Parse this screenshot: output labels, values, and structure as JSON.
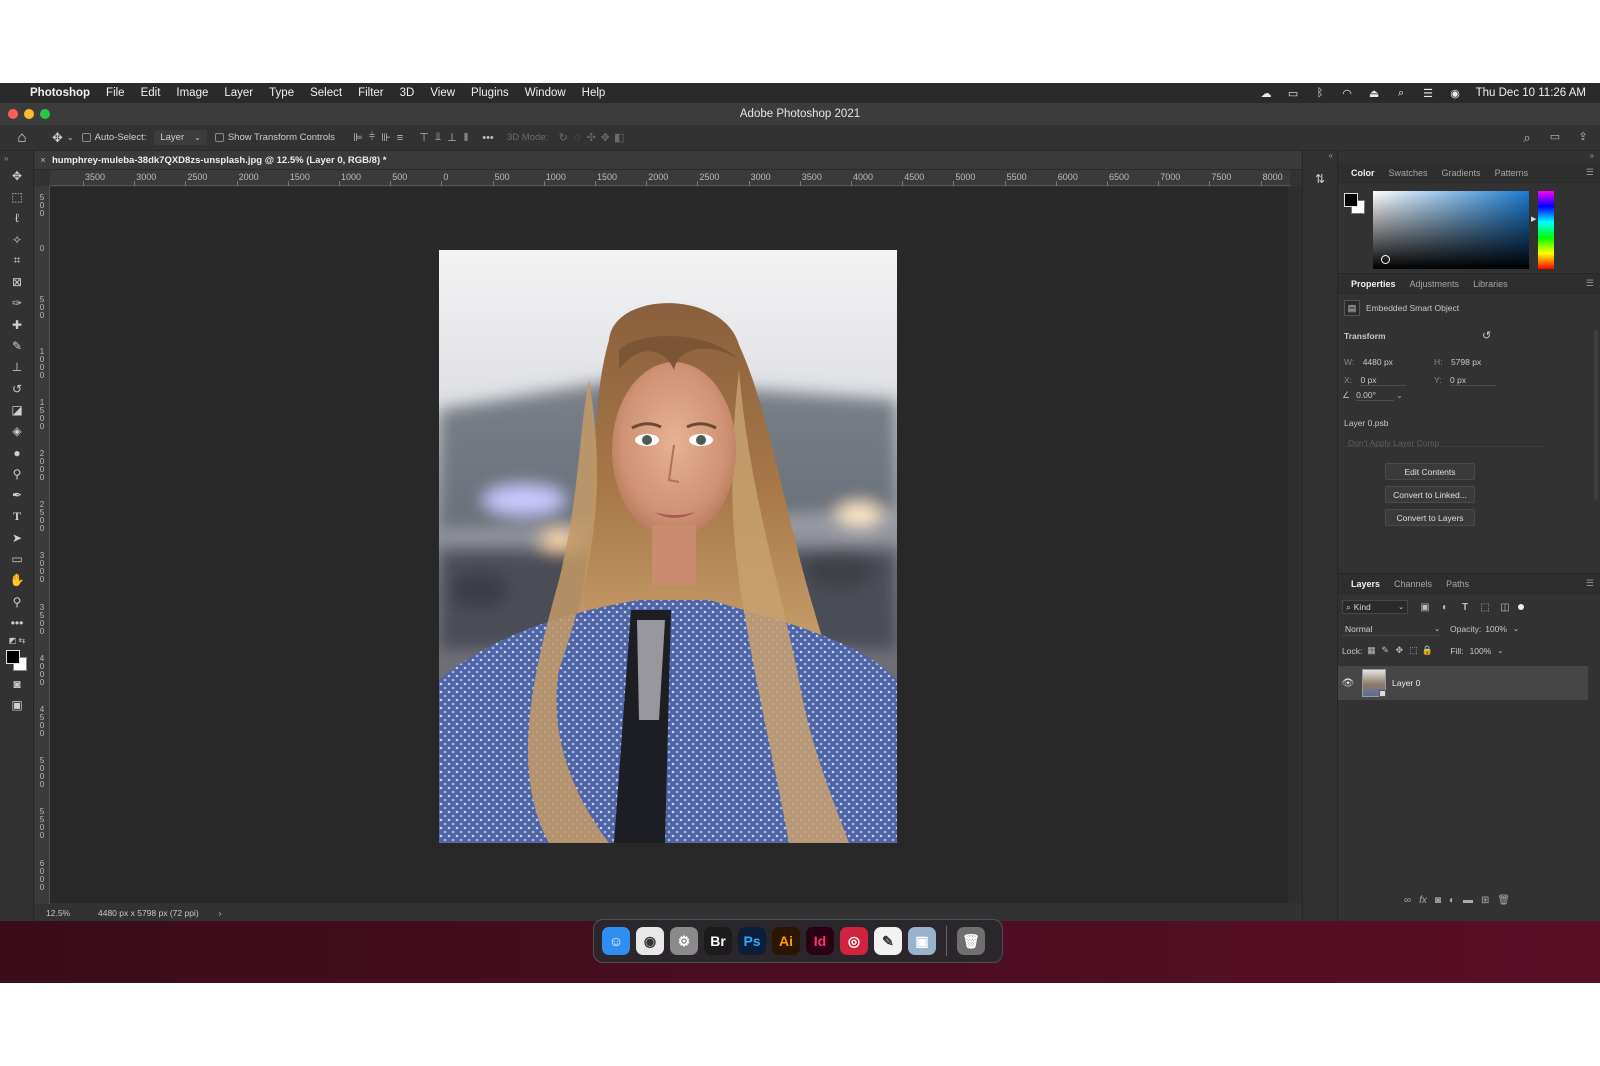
{
  "menubar": {
    "app_name": "Photoshop",
    "items": [
      "File",
      "Edit",
      "Image",
      "Layer",
      "Type",
      "Select",
      "Filter",
      "3D",
      "View",
      "Plugins",
      "Window",
      "Help"
    ],
    "clock": "Thu Dec 10  11:26 AM"
  },
  "window": {
    "title": "Adobe Photoshop 2021"
  },
  "options_bar": {
    "auto_select_label": "Auto-Select:",
    "auto_select_value": "Layer",
    "show_transform_label": "Show Transform Controls",
    "mode_3d_label": "3D Mode:"
  },
  "document": {
    "tab_title": "humphrey-muleba-38dk7QXD8zs-unsplash.jpg @ 12.5% (Layer 0, RGB/8) *"
  },
  "ruler": {
    "h_ticks": [
      "3500",
      "3000",
      "2500",
      "2000",
      "1500",
      "1000",
      "500",
      "0",
      "500",
      "1000",
      "1500",
      "2000",
      "2500",
      "3000",
      "3500",
      "4000",
      "4500",
      "5000",
      "5500",
      "6000",
      "6500",
      "7000",
      "7500",
      "8000"
    ],
    "v_ticks": [
      "500",
      "0",
      "500",
      "1000",
      "1500",
      "2000",
      "2500",
      "3000",
      "3500",
      "4000",
      "4500",
      "5000",
      "5500",
      "6000"
    ]
  },
  "status": {
    "zoom": "12.5%",
    "doc_info": "4480 px x 5798 px (72 ppi)"
  },
  "color_panel": {
    "tabs": [
      "Color",
      "Swatches",
      "Gradients",
      "Patterns"
    ],
    "foreground": "#000000",
    "background": "#ffffff",
    "hue_color": "#1a7bd1"
  },
  "properties_panel": {
    "tabs": [
      "Properties",
      "Adjustments",
      "Libraries"
    ],
    "object_type": "Embedded Smart Object",
    "transform_label": "Transform",
    "w_label": "W:",
    "w_value": "4480 px",
    "h_label": "H:",
    "h_value": "5798 px",
    "x_label": "X:",
    "x_value": "0 px",
    "y_label": "Y:",
    "y_value": "0 px",
    "angle_value": "0.00°",
    "layer_file": "Layer 0.psb",
    "layer_comp_placeholder": "Don't Apply Layer Comp",
    "buttons": [
      "Edit Contents",
      "Convert to Linked...",
      "Convert to Layers"
    ]
  },
  "layers_panel": {
    "tabs": [
      "Layers",
      "Channels",
      "Paths"
    ],
    "filter_label": "Kind",
    "blend_mode": "Normal",
    "opacity_label": "Opacity:",
    "opacity_value": "100%",
    "lock_label": "Lock:",
    "fill_label": "Fill:",
    "fill_value": "100%",
    "layers": [
      {
        "name": "Layer 0",
        "visible": true
      }
    ]
  },
  "dock": {
    "apps": [
      {
        "name": "Finder",
        "glyph": "☺",
        "color": "#2f8ef0"
      },
      {
        "name": "Chrome",
        "glyph": "◉",
        "color": "#e8e8e8"
      },
      {
        "name": "System Preferences",
        "glyph": "⚙",
        "color": "#8a8a8a"
      },
      {
        "name": "Bridge",
        "glyph": "Br",
        "color": "#1b1b1b"
      },
      {
        "name": "Photoshop",
        "glyph": "Ps",
        "color": "#0b1f3a"
      },
      {
        "name": "Illustrator",
        "glyph": "Ai",
        "color": "#2b1400"
      },
      {
        "name": "InDesign",
        "glyph": "Id",
        "color": "#2b0014"
      },
      {
        "name": "Creative Cloud",
        "glyph": "◎",
        "color": "#d0233e"
      },
      {
        "name": "TextEdit",
        "glyph": "✎",
        "color": "#f2f2f2"
      },
      {
        "name": "Preview",
        "glyph": "▣",
        "color": "#9ab3cc"
      },
      {
        "name": "Trash",
        "glyph": "🗑",
        "color": "#6f6f6f"
      }
    ]
  }
}
